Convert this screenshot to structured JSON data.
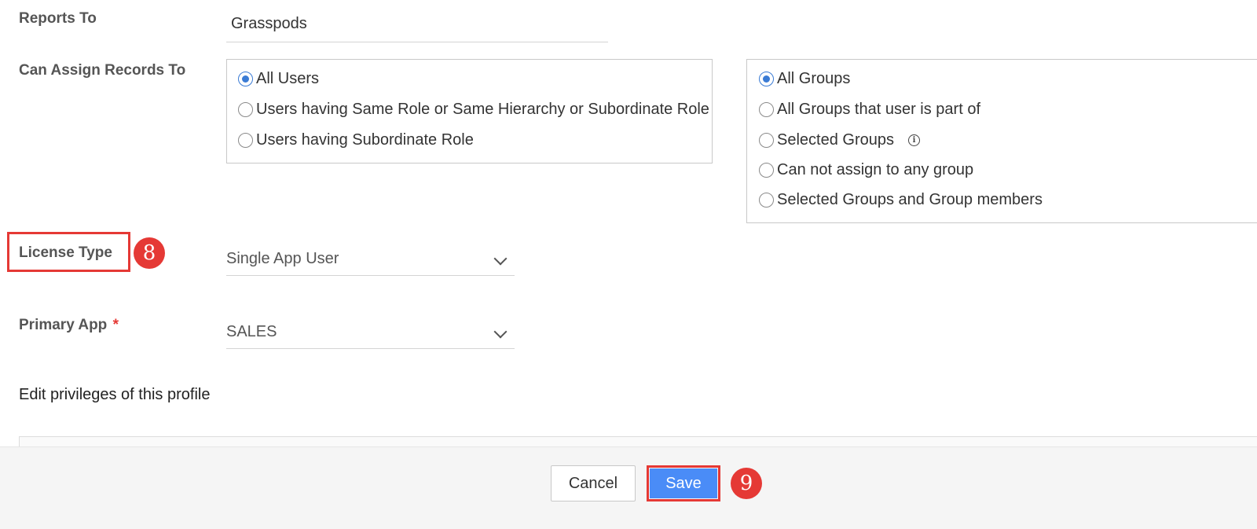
{
  "reports_to": {
    "label": "Reports To",
    "value": "Grasspods"
  },
  "assign_records": {
    "label": "Can Assign Records To",
    "user_options": [
      {
        "label": "All Users",
        "checked": true
      },
      {
        "label": "Users having Same Role or Same Hierarchy or Subordinate Role",
        "checked": false
      },
      {
        "label": "Users having Subordinate Role",
        "checked": false
      }
    ],
    "group_options": [
      {
        "label": "All Groups",
        "checked": true
      },
      {
        "label": "All Groups that user is part of",
        "checked": false
      },
      {
        "label": "Selected Groups",
        "checked": false
      },
      {
        "label": "Can not assign to any group",
        "checked": false
      },
      {
        "label": "Selected Groups and Group members",
        "checked": false
      }
    ]
  },
  "license_type": {
    "label": "License Type",
    "value": "Single App User",
    "step": "8"
  },
  "primary_app": {
    "label": "Primary App",
    "required_mark": "*",
    "value": "SALES"
  },
  "privileges": {
    "title": "Edit privileges of this profile"
  },
  "footer": {
    "cancel_label": "Cancel",
    "save_label": "Save",
    "step": "9"
  },
  "colors": {
    "accent": "#3a7bd5",
    "save_button": "#4a8cf7",
    "annotation_red": "#e53935"
  }
}
